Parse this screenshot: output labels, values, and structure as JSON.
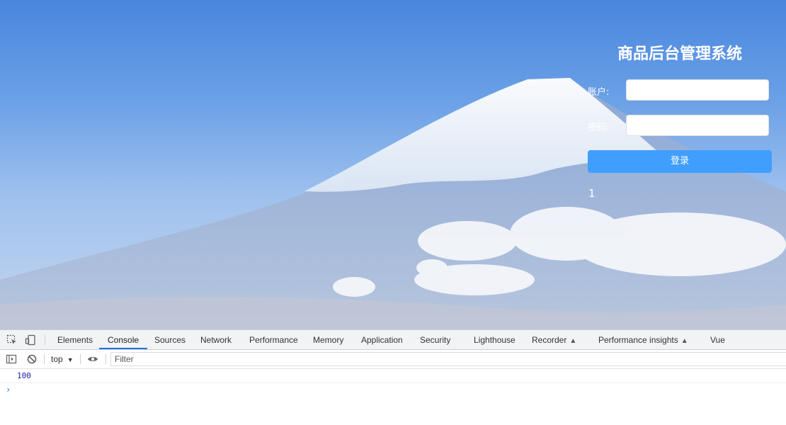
{
  "login": {
    "title": "商品后台管理系统",
    "account_label": "账户:",
    "account_value": "",
    "password_label": "密码:",
    "password_value": "",
    "submit_label": "登录",
    "counter": "1"
  },
  "devtools": {
    "tabs": [
      "Elements",
      "Console",
      "Sources",
      "Network",
      "Performance",
      "Memory",
      "Application",
      "Security",
      "Lighthouse",
      "Recorder",
      "Performance insights",
      "Vue"
    ],
    "active_tab": "Console",
    "context": "top",
    "filter_placeholder": "Filter",
    "log_value": "100",
    "prompt": "›"
  },
  "colors": {
    "accent": "#409eff",
    "devtools_active": "#1a73e8"
  }
}
